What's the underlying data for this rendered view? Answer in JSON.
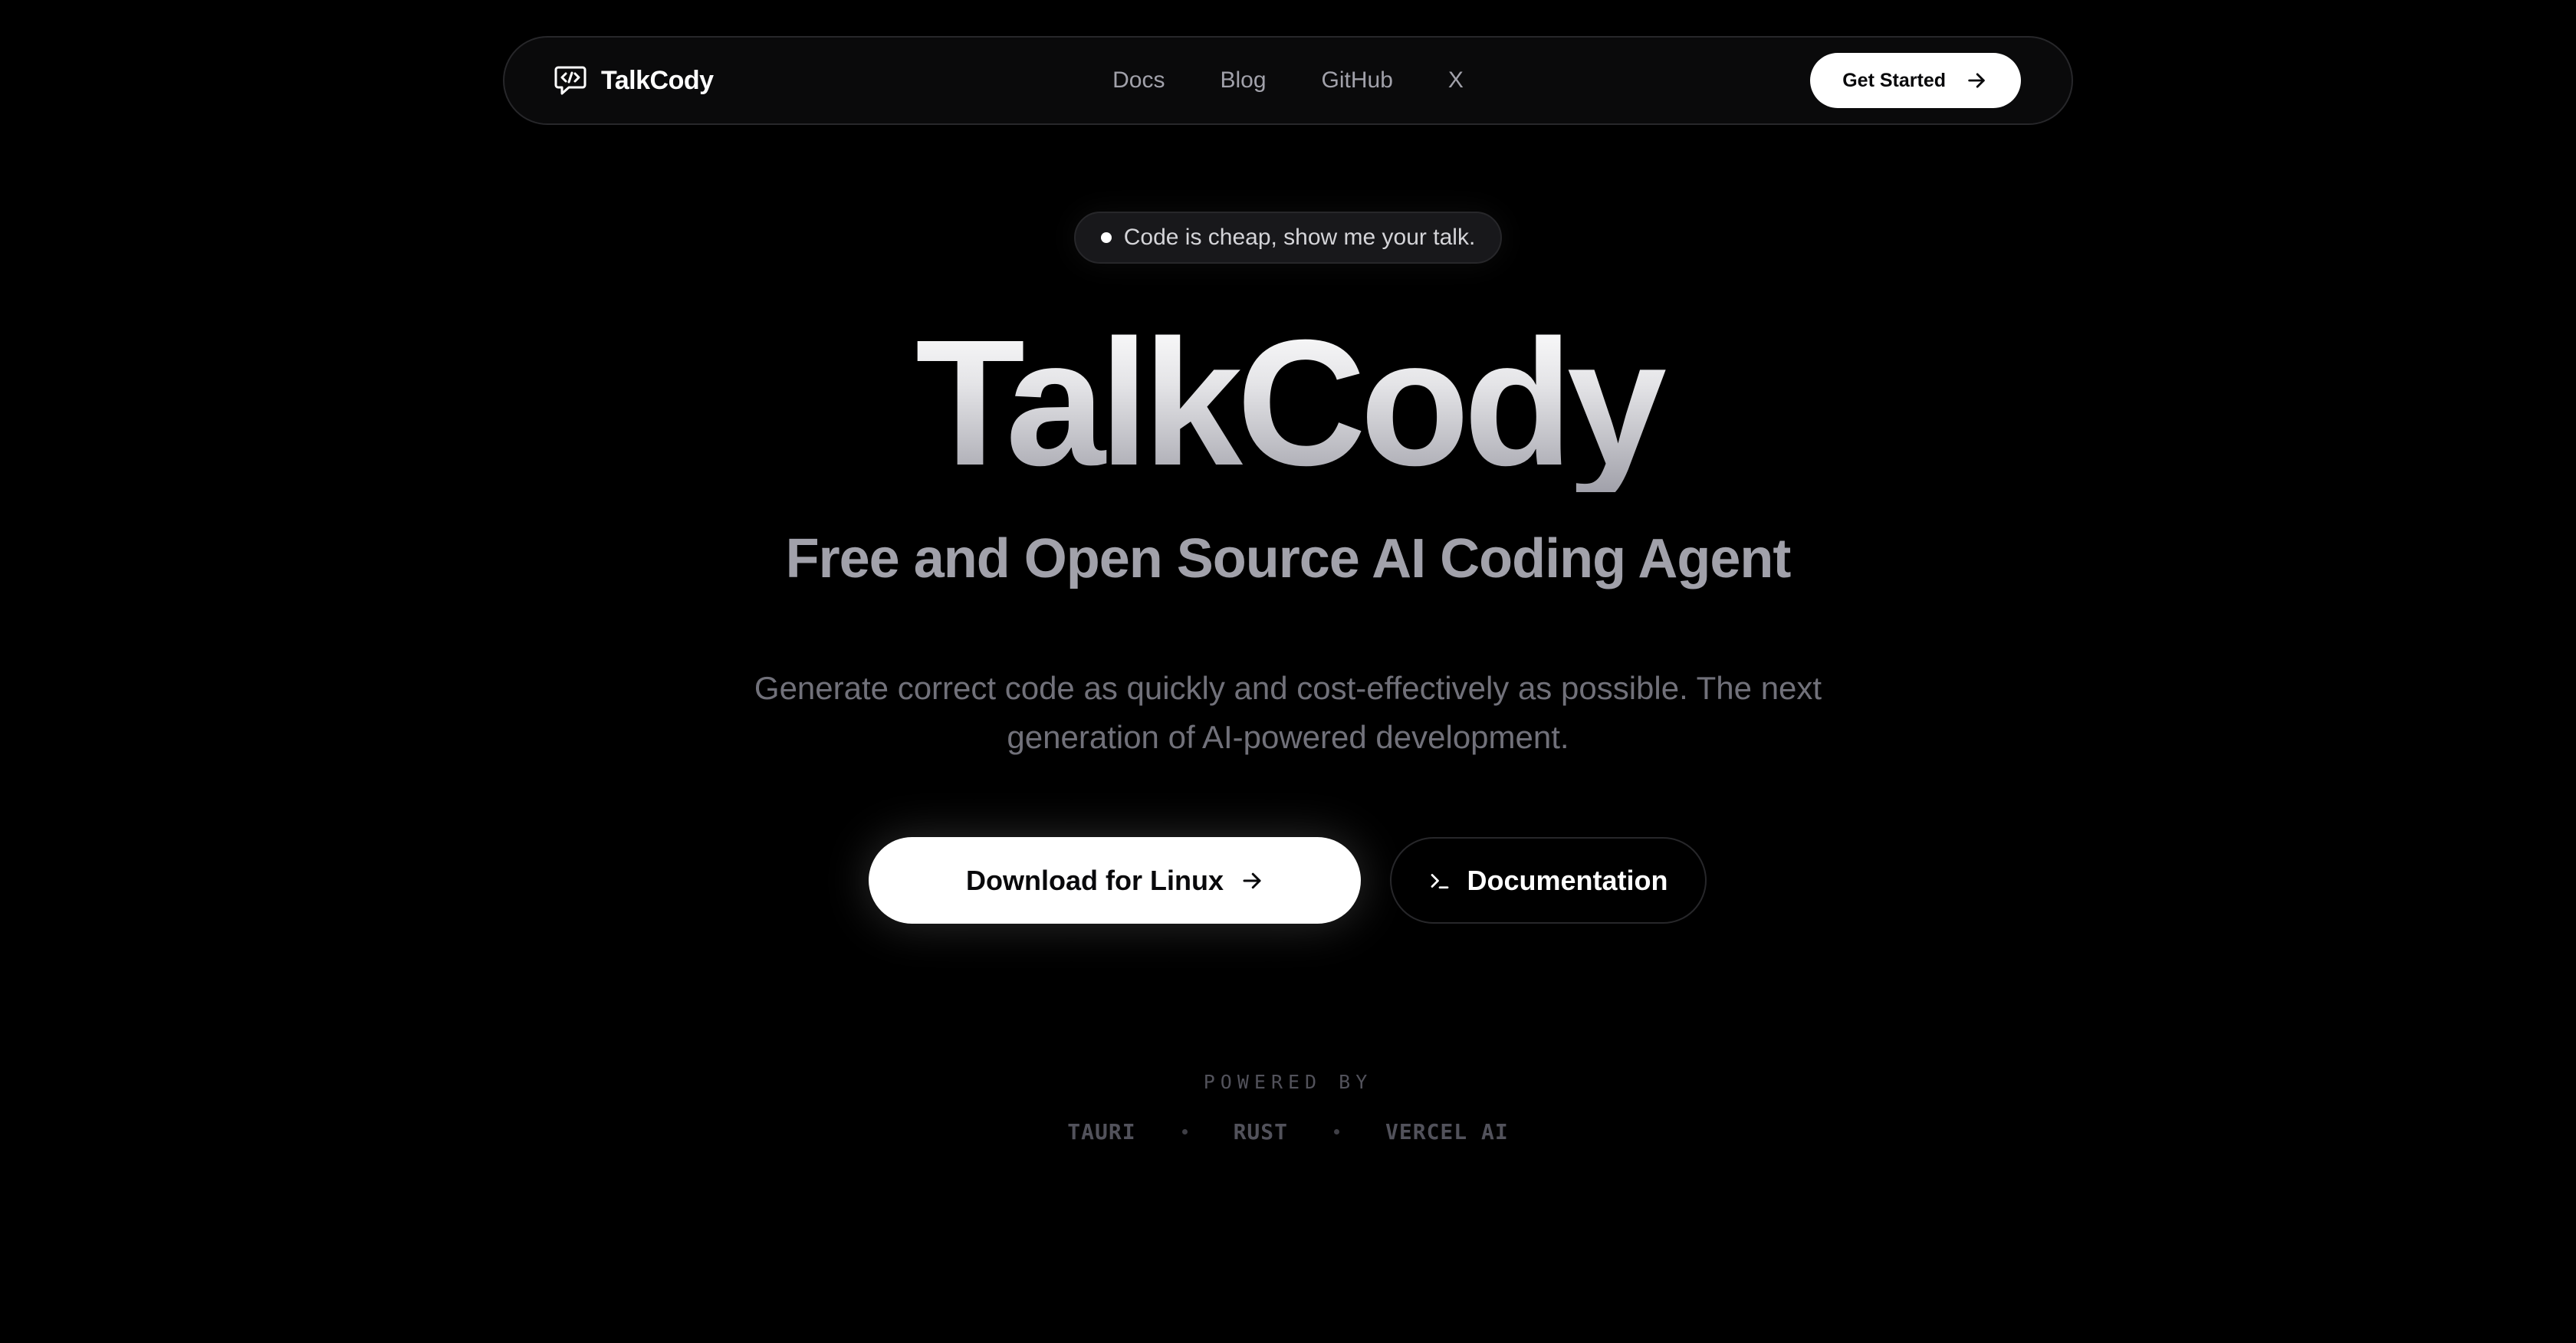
{
  "nav": {
    "brand": "TalkCody",
    "links": [
      "Docs",
      "Blog",
      "GitHub",
      "X"
    ],
    "cta_label": "Get Started"
  },
  "hero": {
    "tagline": "Code is cheap, show me your talk.",
    "title": "TalkCody",
    "subtitle": "Free and Open Source AI Coding Agent",
    "description": "Generate correct code as quickly and cost-effectively as possible. The next generation of AI-powered development.",
    "primary_cta": "Download for Linux",
    "secondary_cta": "Documentation"
  },
  "powered_by": {
    "label": "POWERED BY",
    "items": [
      "TAURI",
      "RUST",
      "VERCEL AI"
    ]
  },
  "icons": {
    "brand": "chat-code-icon",
    "cta_arrow": "arrow-right-icon",
    "docs": "terminal-icon"
  },
  "colors": {
    "background": "#000000",
    "primary_button": "#ffffff",
    "muted_text": "#71717a",
    "border": "#27272a"
  }
}
